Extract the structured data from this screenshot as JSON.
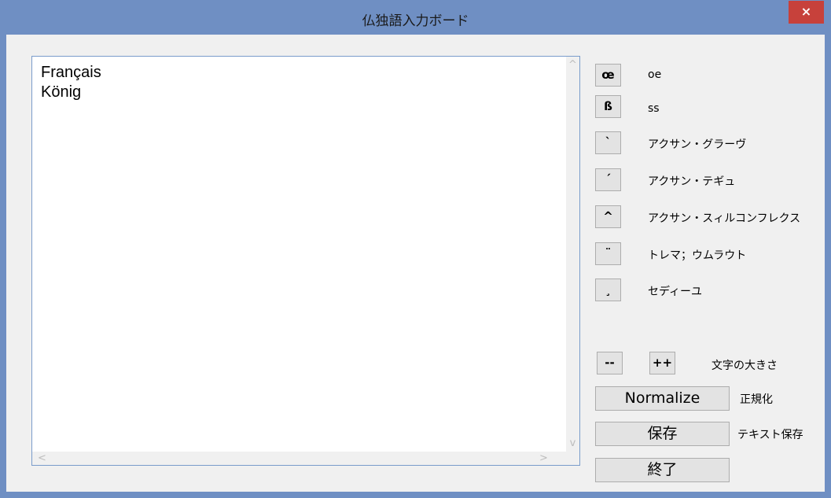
{
  "window": {
    "title": "仏独語入力ボード",
    "close_label": "×"
  },
  "editor": {
    "text": "Français\nKönig"
  },
  "scroll": {
    "up": "^",
    "down": "v",
    "left": "<",
    "right": ">"
  },
  "chars": [
    {
      "symbol": "œ",
      "label": "oe"
    },
    {
      "symbol": "ß",
      "label": "ss"
    },
    {
      "symbol": "`",
      "label": "アクサン・グラーヴ"
    },
    {
      "symbol": "´",
      "label": "アクサン・テギュ"
    },
    {
      "symbol": "^",
      "label": "アクサン・スィルコンフレクス"
    },
    {
      "symbol": "¨",
      "label": "トレマ；ウムラウト"
    },
    {
      "symbol": "¸",
      "label": "セディーユ"
    }
  ],
  "font_size": {
    "decrease": "--",
    "increase": "++",
    "label": "文字の大きさ"
  },
  "normalize": {
    "button": "Normalize",
    "label": "正規化"
  },
  "save": {
    "button": "保存",
    "label": "テキスト保存"
  },
  "exit": {
    "button": "終了"
  }
}
